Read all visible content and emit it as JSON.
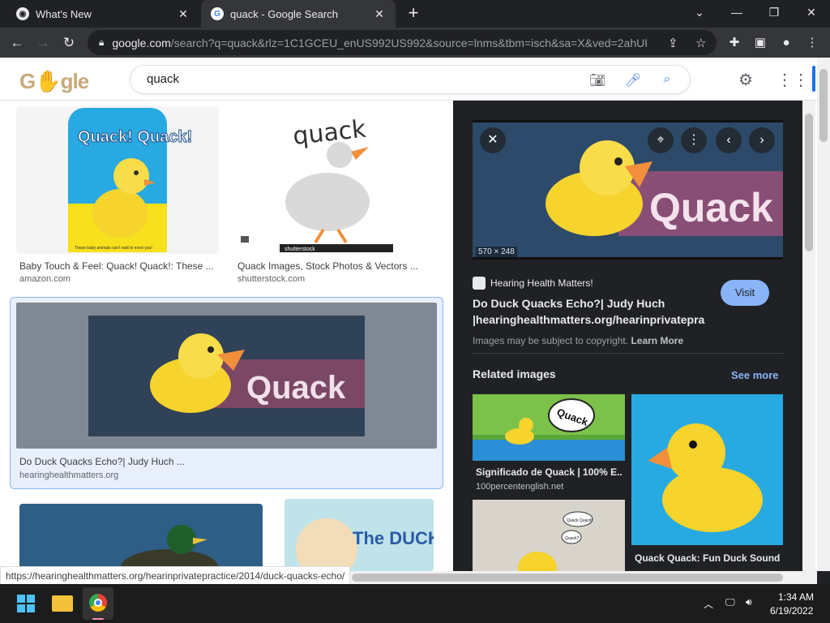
{
  "browser": {
    "tabs": [
      {
        "title": "What's New",
        "active": false
      },
      {
        "title": "quack - Google Search",
        "active": true
      }
    ],
    "address": {
      "domain": "google.com",
      "path": "/search?q=quack&rlz=1C1GCEU_enUS992US992&source=lnms&tbm=isch&sa=X&ved=2ahUK..."
    }
  },
  "google": {
    "logo_text": "Google",
    "search_query": "quack"
  },
  "results": [
    {
      "title": "Baby Touch & Feel: Quack! Quack!: These ...",
      "site": "amazon.com"
    },
    {
      "title": "Quack Images, Stock Photos & Vectors ...",
      "site": "shutterstock.com"
    },
    {
      "title": "Do Duck Quacks Echo?| Judy Huch ...",
      "site": "hearinghealthmatters.org"
    }
  ],
  "thumb_labels": {
    "book_title": "Quack! Quack!",
    "book_caption": "These baby animals can't wait to meet you!",
    "quack_word": "quack",
    "shutterstock": "shutterstock",
    "quack_banner": "Quack",
    "duck_book": "The DUCK"
  },
  "panel": {
    "image_dims": "570 × 248",
    "source": "Hearing Health Matters!",
    "title": "Do Duck Quacks Echo?| Judy Huch |hearinghealthmatters.org/hearinprivatepra",
    "visit_label": "Visit",
    "copyright_text": "Images may be subject to copyright.",
    "learn_more": "Learn More",
    "related_title": "Related images",
    "see_more": "See more",
    "related": [
      {
        "title": "Significado de Quack | 100% E...",
        "site": "100percentenglish.net",
        "bubble": "Quack"
      },
      {
        "title": "Quack Quack: Fun Duck Sound...",
        "site": ""
      },
      {
        "bubble1": "Quack Quack!",
        "bubble2": "Quack?"
      }
    ]
  },
  "status_url": "https://hearinghealthmatters.org/hearinprivatepractice/2014/duck-quacks-echo/",
  "taskbar": {
    "time": "1:34 AM",
    "date": "6/19/2022"
  },
  "colors": {
    "accent_blue": "#1a73e8",
    "panel_bg": "#202124",
    "visit_btn": "#8ab4f8",
    "duck_yellow": "#f6d32d"
  }
}
